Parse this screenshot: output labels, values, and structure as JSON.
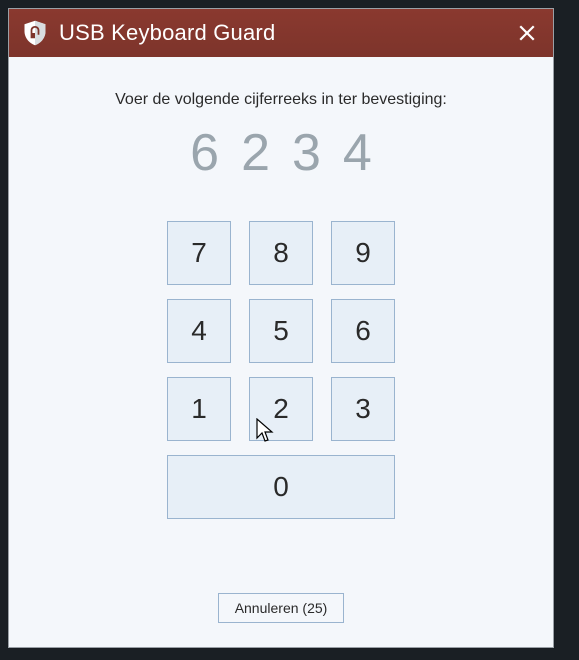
{
  "titlebar": {
    "app_name": "USB Keyboard Guard",
    "shield_icon": "shield-icon",
    "close_icon": "close-icon",
    "accent_color": "#7d342b"
  },
  "content": {
    "instruction": "Voer de volgende cijferreeks in ter bevestiging:",
    "code_digits": [
      "6",
      "2",
      "3",
      "4"
    ]
  },
  "keypad": {
    "rows": [
      [
        "7",
        "8",
        "9"
      ],
      [
        "4",
        "5",
        "6"
      ],
      [
        "1",
        "2",
        "3"
      ]
    ],
    "zero": "0"
  },
  "footer": {
    "cancel_label": "Annuleren (25)"
  }
}
